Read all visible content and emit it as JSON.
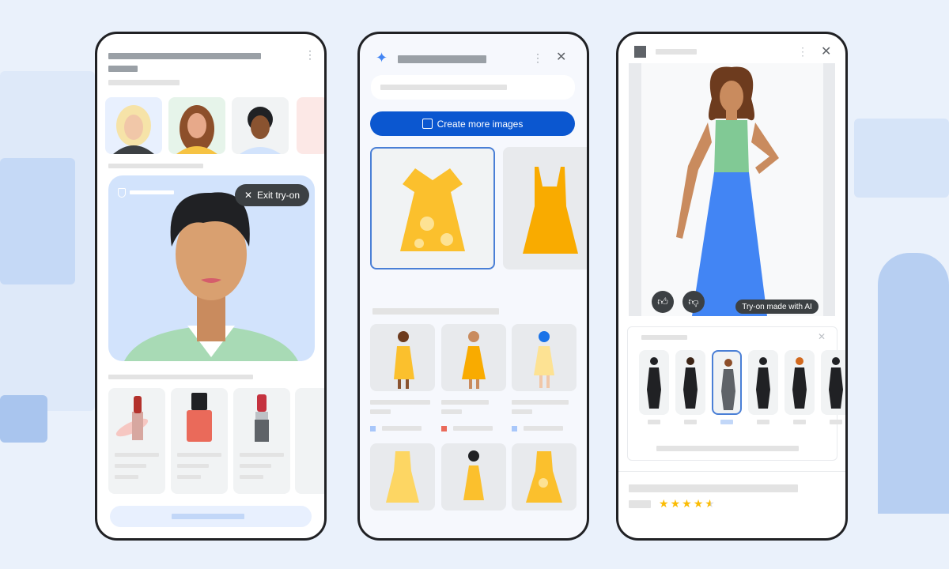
{
  "phone1": {
    "exit_label": "Exit try-on",
    "icons": {
      "menu": "kebab-menu-icon",
      "close": "close-icon",
      "shield": "shield-icon"
    }
  },
  "phone2": {
    "create_label": "Create more images",
    "icons": {
      "logo": "sparkle-icon",
      "menu": "kebab-menu-icon",
      "close": "close-icon",
      "image": "add-image-icon"
    }
  },
  "phone3": {
    "ai_badge": "Try-on made with AI",
    "rating": 4.5,
    "rating_max": 5,
    "selected_body_index": 2,
    "icons": {
      "up": "thumbs-up-icon",
      "down": "thumbs-down-icon",
      "close": "close-icon",
      "menu": "kebab-menu-icon"
    }
  },
  "colors": {
    "accent": "#0b57d0",
    "selected": "#4a7fd6",
    "star": "#fbbc04",
    "tryon_bg": "#d2e3fc",
    "pill": "#3c4043"
  }
}
